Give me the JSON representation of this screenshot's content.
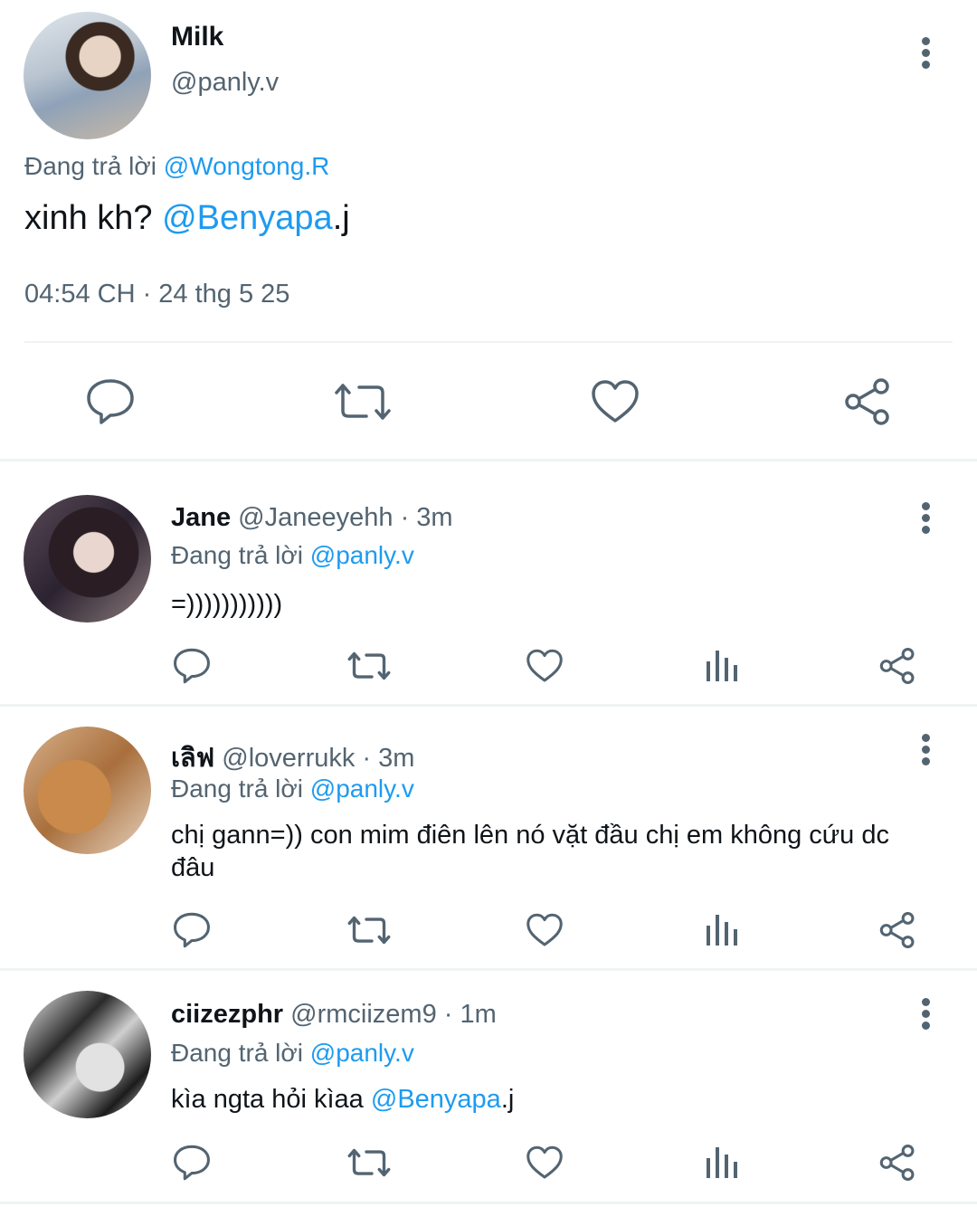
{
  "main_tweet": {
    "name": "Milk",
    "handle": "@panly.v",
    "replying_prefix": "Đang trả lời",
    "replying_to": "@Wongtong.R",
    "text_before": "xinh kh? ",
    "text_mention": "@Benyapa",
    "text_after": ".j",
    "timestamp": "04:54 CH · 24 thg 5 25",
    "actions": [
      "reply-icon",
      "retweet-icon",
      "like-icon",
      "share-icon"
    ]
  },
  "replies": [
    {
      "name": "Jane",
      "handle": "@Janeeyehh · 3m",
      "replying_prefix": "Đang trả lời",
      "replying_to": "@panly.v",
      "text": "=)))))))))))"
    },
    {
      "name": "เลิฟ",
      "handle": "@loverrukk · 3m",
      "replying_prefix": "Đang trả lời",
      "replying_to": "@panly.v",
      "text": "chị gann=)) con mim điên lên nó vặt đầu chị em không cứu dc đâu"
    },
    {
      "name": "ciizezphr",
      "handle": "@rmciizem9 · 1m",
      "replying_prefix": "Đang trả lời",
      "replying_to": "@panly.v",
      "text_before": "kìa ngta hỏi kìaa ",
      "text_mention": "@Benyapa",
      "text_after": ".j"
    }
  ],
  "colors": {
    "accent": "#1d9bf0",
    "secondary_text": "#536471",
    "primary_text": "#0f1419",
    "divider": "#eff3f4"
  }
}
